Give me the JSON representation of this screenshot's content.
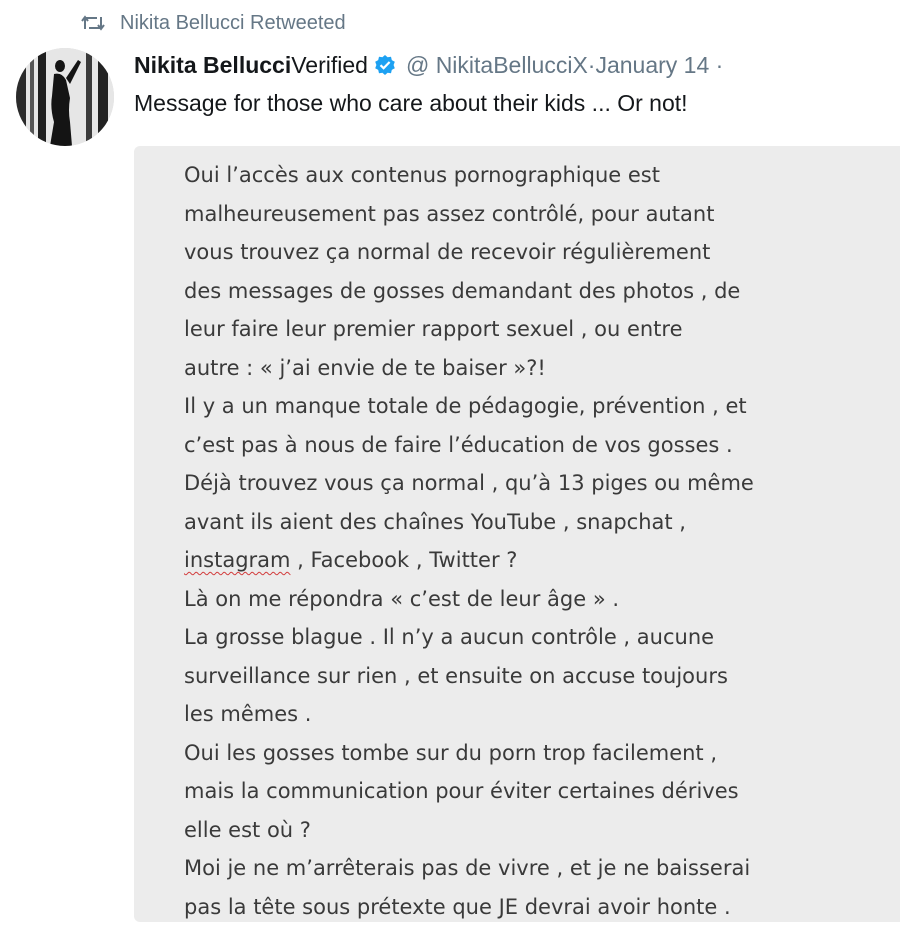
{
  "retweet": {
    "icon": "retweet-icon",
    "text": "Nikita Bellucci Retweeted"
  },
  "tweet": {
    "avatar": "profile-photo",
    "display_name": "Nikita Bellucci",
    "verified_text": "Verified",
    "verified_icon": "verified-badge-icon",
    "handle": "@ NikitaBellucciX",
    "separator": "·",
    "date": "January 14 ·",
    "text": "Message for those who care about their kids ... Or not!",
    "colors": {
      "verified_blue": "#1da1f2",
      "secondary_text": "#657786",
      "image_background": "#ececec"
    }
  },
  "image": {
    "lines": [
      "Oui l’accès aux contenus pornographique est",
      "malheureusement pas assez contrôlé, pour autant",
      "vous trouvez ça normal de recevoir régulièrement",
      "des messages de gosses demandant des photos , de",
      "leur faire leur premier rapport sexuel , ou entre",
      "autre : «  j’ai envie de te baiser »?!",
      "Il y a un manque totale de pédagogie, prévention , et",
      "c’est pas à nous de faire l’éducation de vos gosses .",
      "Déjà trouvez vous ça normal , qu’à 13 piges ou même",
      "avant ils aient des chaînes YouTube , snapchat ,",
      "instagram , Facebook , Twitter ?",
      "Là on me répondra «  c’est de leur âge » .",
      "La grosse blague . Il n’y a aucun contrôle , aucune",
      "surveillance sur rien , et ensuite on accuse toujours",
      "les mêmes .",
      "Oui les gosses tombe sur du porn trop facilement  ,",
      "mais la communication pour éviter certaines dérives",
      "elle est où ?",
      "Moi je ne m’arrêterais pas de vivre , et je ne baisserai",
      "pas la tête sous prétexte que JE devrai avoir honte ."
    ],
    "spell_error_word": "instagram",
    "spell_error_rest": " , Facebook , Twitter ?"
  }
}
